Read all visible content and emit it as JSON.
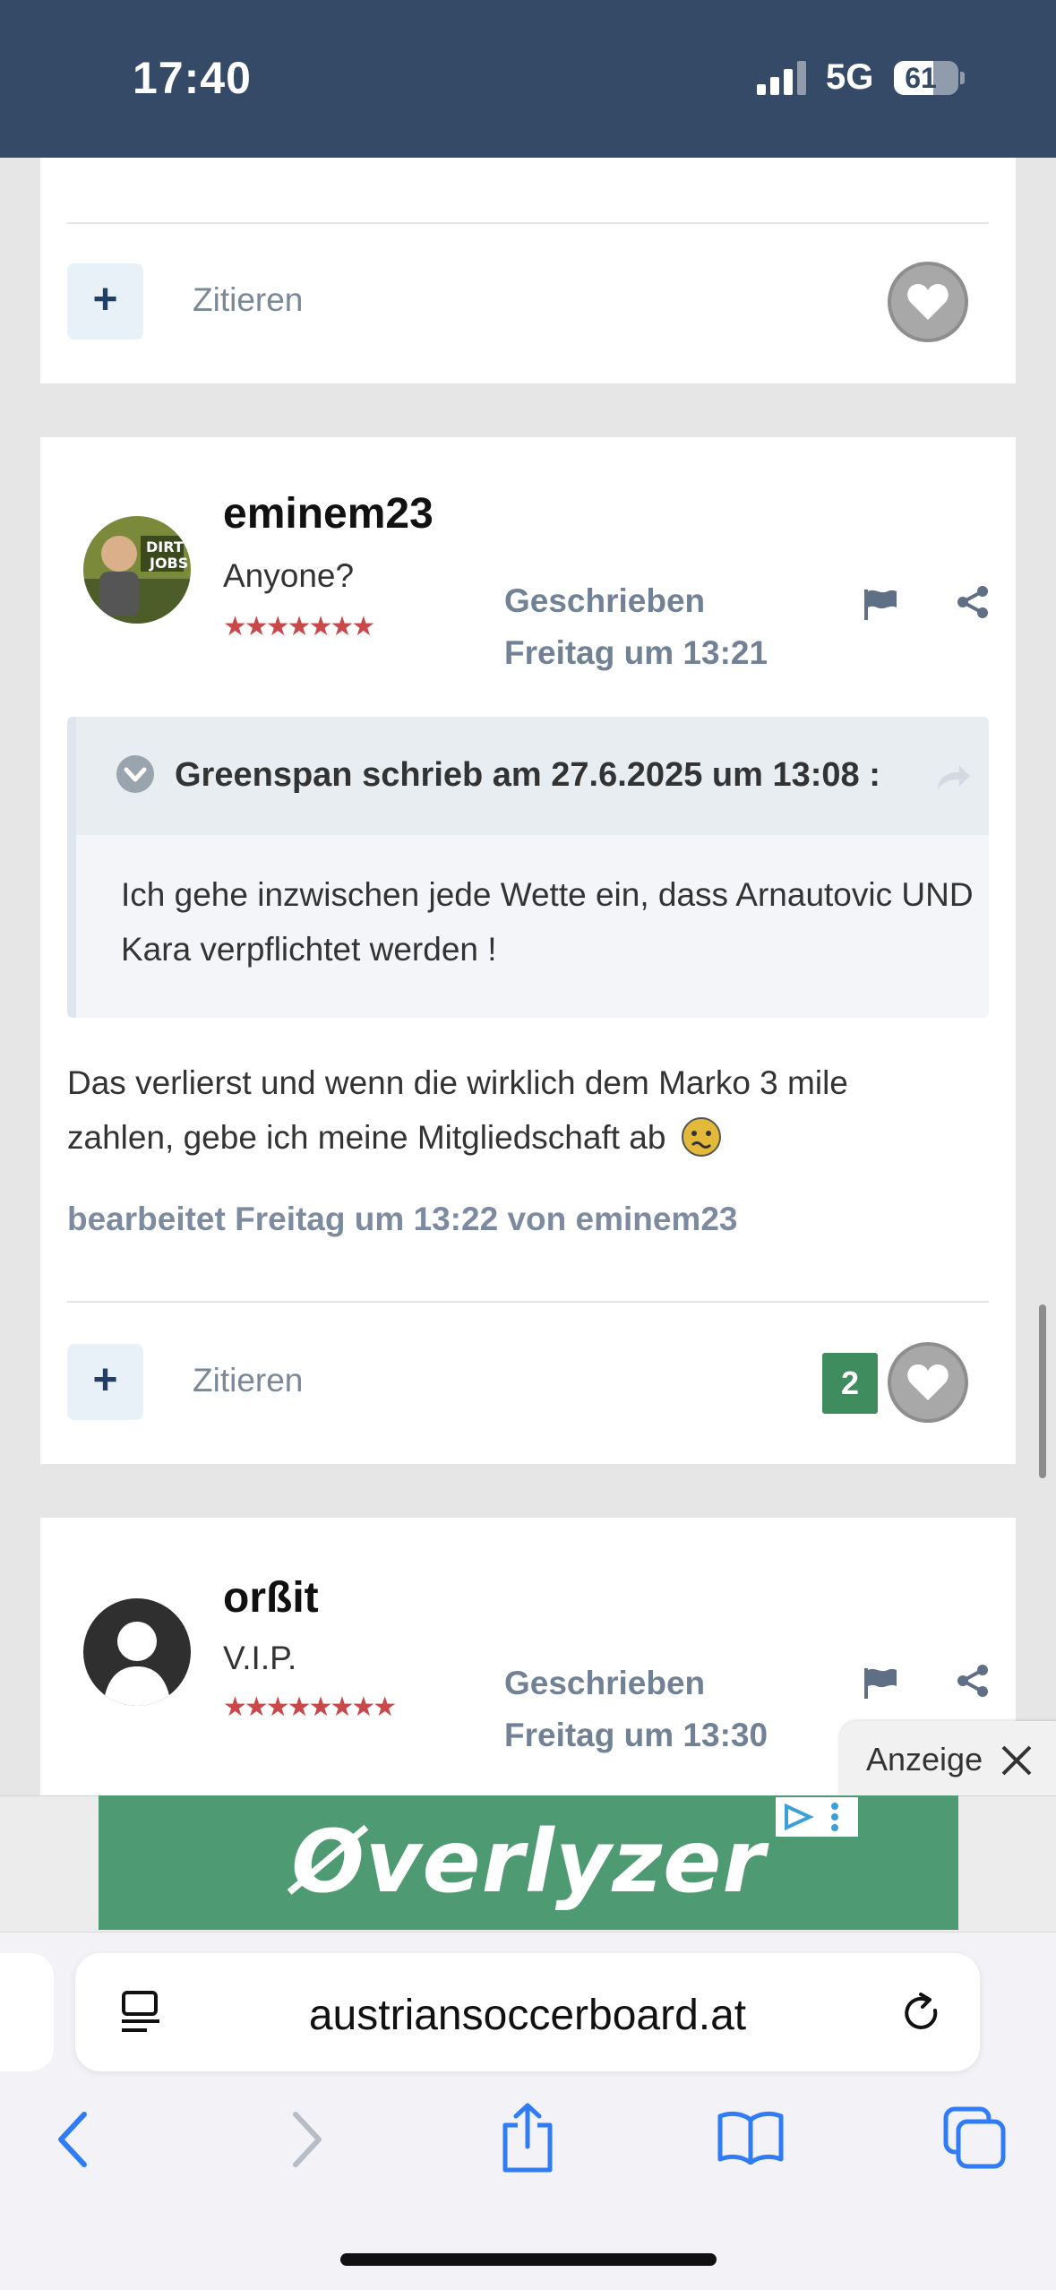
{
  "status_bar": {
    "time": "17:40",
    "network": "5G",
    "battery": "61",
    "battery_level_percent": 61
  },
  "post_top": {
    "quote_label": "Zitieren"
  },
  "post_main": {
    "username": "eminem23",
    "user_title": "Anyone?",
    "stars": "★★★★★★★",
    "posted_label": "Geschrieben",
    "posted_time": "Freitag um 13:21",
    "quote": {
      "header": "Greenspan schrieb am 27.6.2025 um 13:08 :",
      "text": "Ich gehe inzwischen jede Wette ein, dass Arnautovic UND Kara verpflichtet werden !"
    },
    "body_line1": "Das verlierst und wenn die wirklich dem Marko 3 mile",
    "body_line2": "zahlen, gebe ich meine Mitgliedschaft ab",
    "edited": "bearbeitet Freitag um 13:22 von eminem23",
    "quote_label": "Zitieren",
    "like_count": "2"
  },
  "post_next": {
    "username": "orßit",
    "user_title": "V.I.P.",
    "stars": "★★★★★★★★",
    "posted_label": "Geschrieben",
    "posted_time": "Freitag um 13:30"
  },
  "ad": {
    "label": "Anzeige",
    "brand": "Øverlyzer"
  },
  "browser": {
    "url": "austriansoccerboard.at"
  },
  "colors": {
    "header": "#354a66",
    "accent": "#1f3f68",
    "like_green": "#3f8c5f",
    "ad_green": "#4e9a72"
  }
}
